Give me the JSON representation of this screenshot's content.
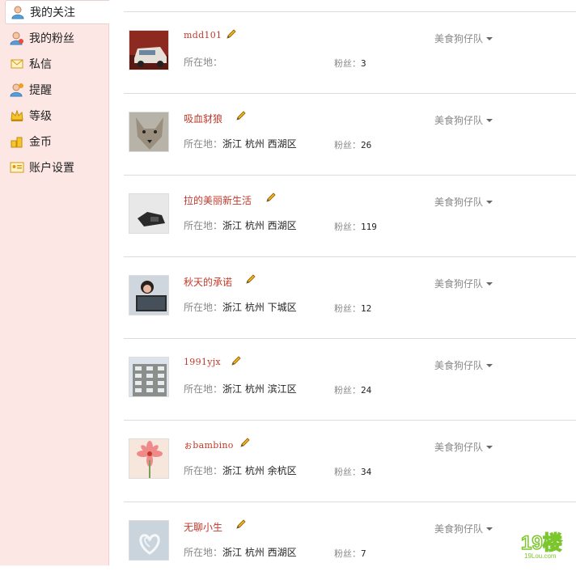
{
  "sidebar": {
    "items": [
      {
        "label": "我的关注",
        "icon": "user-icon",
        "active": true
      },
      {
        "label": "我的粉丝",
        "icon": "fans-icon",
        "active": false
      },
      {
        "label": "私信",
        "icon": "mail-icon",
        "active": false
      },
      {
        "label": "提醒",
        "icon": "reminder-icon",
        "active": false
      },
      {
        "label": "等级",
        "icon": "crown-icon",
        "active": false
      },
      {
        "label": "金币",
        "icon": "coins-icon",
        "active": false
      },
      {
        "label": "账户设置",
        "icon": "account-card-icon",
        "active": false
      }
    ]
  },
  "follow_list": {
    "location_label": "所在地：",
    "fans_label": "粉丝：",
    "users": [
      {
        "name": "mdd101",
        "location": "",
        "fans": "3",
        "group": "美食狗仔队",
        "avatar": "car-photo"
      },
      {
        "name": "吸血豺狼",
        "location": "浙江 杭州 西湖区",
        "fans": "26",
        "group": "美食狗仔队",
        "avatar": "wolf-photo"
      },
      {
        "name": "拉的美丽新生活",
        "location": "浙江 杭州 西湖区",
        "fans": "119",
        "group": "美食狗仔队",
        "avatar": "hands-photo"
      },
      {
        "name": "秋天的承诺",
        "location": "浙江 杭州 下城区",
        "fans": "12",
        "group": "美食狗仔队",
        "avatar": "person-laptop-photo"
      },
      {
        "name": "1991yjx",
        "location": "浙江 杭州 滨江区",
        "fans": "24",
        "group": "美食狗仔队",
        "avatar": "building-photo"
      },
      {
        "name": "ぉbambino",
        "location": "浙江 杭州 余杭区",
        "fans": "34",
        "group": "美食狗仔队",
        "avatar": "flower-photo"
      },
      {
        "name": "无聊小生",
        "location": "浙江 杭州 西湖区",
        "fans": "7",
        "group": "美食狗仔队",
        "avatar": "hearts-photo"
      }
    ]
  },
  "watermark": {
    "main": "19楼",
    "sub": "19Lou.com"
  },
  "colors": {
    "sidebar_bg": "#fde7e5",
    "username": "#c0392b",
    "muted": "#888888",
    "brand_green": "#7cc62d"
  }
}
